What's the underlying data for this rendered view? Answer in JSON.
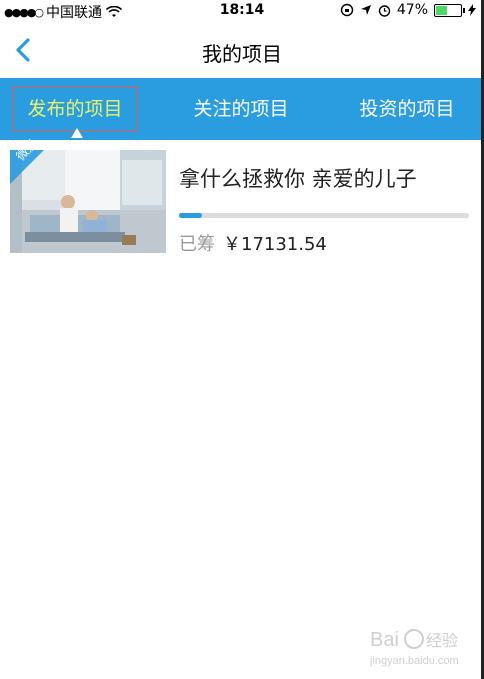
{
  "status": {
    "carrier": "中国联通",
    "time": "18:14",
    "battery": "47%",
    "battery_level": 0.47
  },
  "nav": {
    "title": "我的项目"
  },
  "tabs": [
    {
      "label": "发布的项目",
      "active": true
    },
    {
      "label": "关注的项目",
      "active": false
    },
    {
      "label": "投资的项目",
      "active": false
    }
  ],
  "project": {
    "tag": "微爱",
    "title": "拿什么拯救你 亲爱的儿子",
    "raised_label": "已筹",
    "amount": "￥17131.54",
    "progress": 0.08
  },
  "watermark": {
    "brand": "Bai 经验",
    "url": "jingyan.baidu.com"
  },
  "colors": {
    "accent": "#2a9ce0",
    "active_tab": "#e9f26b",
    "highlight": "#e05a5a"
  }
}
